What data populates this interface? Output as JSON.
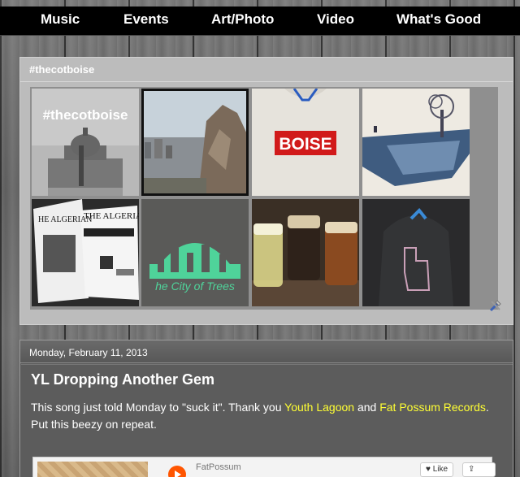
{
  "nav": {
    "items": [
      "Music",
      "Events",
      "Art/Photo",
      "Video",
      "What's Good"
    ]
  },
  "instagram": {
    "title": "#thecotboise",
    "tiles": [
      {
        "caption": "#thecotboise",
        "icon": "capitol-building"
      },
      {
        "caption": "",
        "icon": "city-rock"
      },
      {
        "caption": "BOISE",
        "icon": "boise-tshirt"
      },
      {
        "caption": "",
        "icon": "tree-art"
      },
      {
        "caption": "THE ALGERIAN",
        "icon": "zine"
      },
      {
        "caption": "he City of Trees",
        "icon": "city-of-trees-shirt"
      },
      {
        "caption": "",
        "icon": "beer-flight"
      },
      {
        "caption": "",
        "icon": "idaho-hoodie"
      }
    ]
  },
  "post": {
    "date": "Monday, February 11, 2013",
    "title": "YL Dropping Another Gem",
    "text_before": "This song just told Monday to \"suck it\". Thank you ",
    "link1": "Youth Lagoon",
    "text_and": " and ",
    "link2": "Fat Possum Records",
    "text_after": ". Put this beezy on repeat.",
    "embed": {
      "user": "FatPossum",
      "like": "♥ Like",
      "share": "⇪ Share"
    }
  },
  "colors": {
    "nav_bg": "#000000",
    "link": "#ffff33",
    "post_bg": "#5a5a5a",
    "panel_bg": "#bcbcbc"
  }
}
